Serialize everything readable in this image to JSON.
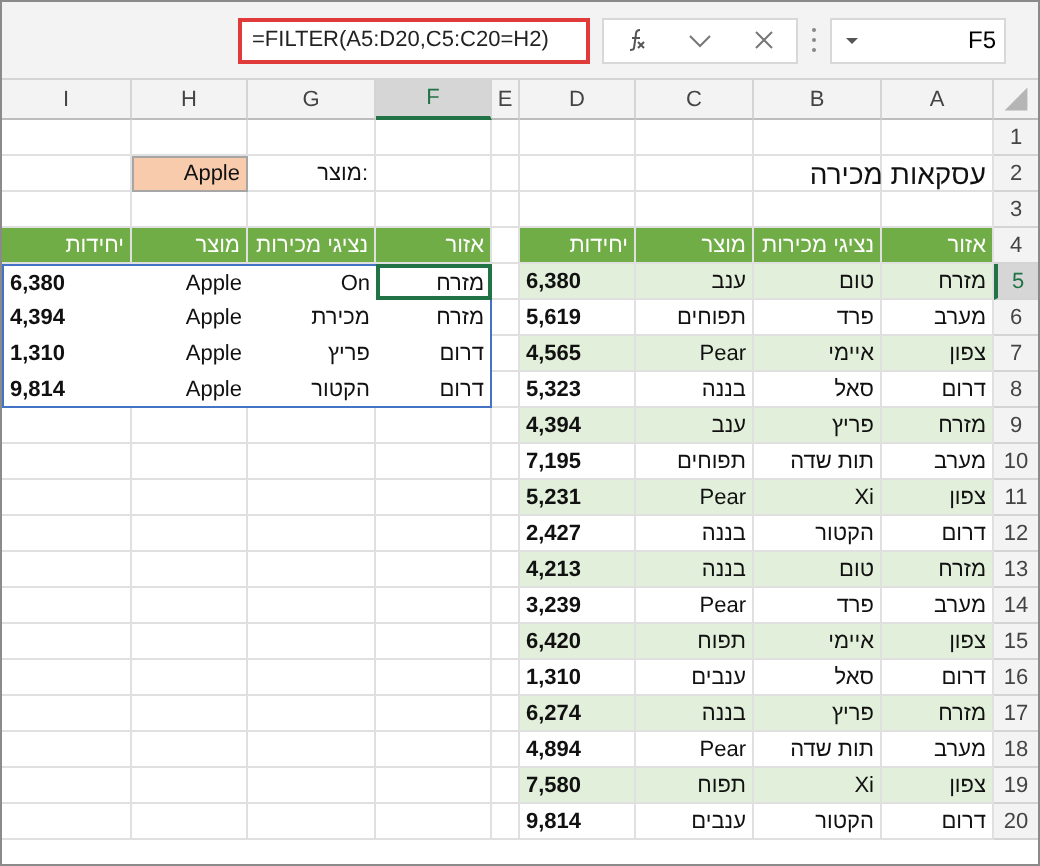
{
  "formula": "=FILTER(A5:D20,C5:C20=H2)",
  "name_box": "F5",
  "columns": [
    {
      "letter": "A",
      "selected": false
    },
    {
      "letter": "B",
      "selected": false
    },
    {
      "letter": "C",
      "selected": false
    },
    {
      "letter": "D",
      "selected": false
    },
    {
      "letter": "E",
      "selected": false
    },
    {
      "letter": "F",
      "selected": true
    },
    {
      "letter": "G",
      "selected": false
    },
    {
      "letter": "H",
      "selected": false
    },
    {
      "letter": "I",
      "selected": false
    }
  ],
  "rows": [
    {
      "number": "1",
      "selected": false
    },
    {
      "number": "2",
      "selected": false
    },
    {
      "number": "3",
      "selected": false
    },
    {
      "number": "4",
      "selected": false
    },
    {
      "number": "5",
      "selected": true
    },
    {
      "number": "6",
      "selected": false
    },
    {
      "number": "7",
      "selected": false
    },
    {
      "number": "8",
      "selected": false
    },
    {
      "number": "9",
      "selected": false
    },
    {
      "number": "10",
      "selected": false
    },
    {
      "number": "11",
      "selected": false
    },
    {
      "number": "12",
      "selected": false
    },
    {
      "number": "13",
      "selected": false
    },
    {
      "number": "14",
      "selected": false
    },
    {
      "number": "15",
      "selected": false
    },
    {
      "number": "16",
      "selected": false
    },
    {
      "number": "17",
      "selected": false
    },
    {
      "number": "18",
      "selected": false
    },
    {
      "number": "19",
      "selected": false
    },
    {
      "number": "20",
      "selected": false
    }
  ],
  "title": "עסקאות מכירה",
  "criteria": {
    "label": "מוצר:",
    "input": "Apple"
  },
  "sales_table": {
    "headers": [
      "אזור",
      "נציגי מכירות",
      "מוצר",
      "יחידות"
    ],
    "rows": [
      {
        "banded": true,
        "cells": [
          "מזרח",
          "טום",
          "ענב",
          "6,380"
        ]
      },
      {
        "banded": false,
        "cells": [
          "מערב",
          "פרד",
          "תפוחים",
          "5,619"
        ]
      },
      {
        "banded": true,
        "cells": [
          "צפון",
          "איימי",
          "Pear",
          "4,565"
        ]
      },
      {
        "banded": false,
        "cells": [
          "דרום",
          "סאל",
          "בננה",
          "5,323"
        ]
      },
      {
        "banded": true,
        "cells": [
          "מזרח",
          "פריץ",
          "ענב",
          "4,394"
        ]
      },
      {
        "banded": false,
        "cells": [
          "מערב",
          "תות שדה",
          "תפוחים",
          "7,195"
        ]
      },
      {
        "banded": true,
        "cells": [
          "צפון",
          "Xi",
          "Pear",
          "5,231"
        ]
      },
      {
        "banded": false,
        "cells": [
          "דרום",
          "הקטור",
          "בננה",
          "2,427"
        ]
      },
      {
        "banded": true,
        "cells": [
          "מזרח",
          "טום",
          "בננה",
          "4,213"
        ]
      },
      {
        "banded": false,
        "cells": [
          "מערב",
          "פרד",
          "Pear",
          "3,239"
        ]
      },
      {
        "banded": true,
        "cells": [
          "צפון",
          "איימי",
          "תפוח",
          "6,420"
        ]
      },
      {
        "banded": false,
        "cells": [
          "דרום",
          "סאל",
          "ענבים",
          "1,310"
        ]
      },
      {
        "banded": true,
        "cells": [
          "מזרח",
          "פריץ",
          "בננה",
          "6,274"
        ]
      },
      {
        "banded": false,
        "cells": [
          "מערב",
          "תות שדה",
          "Pear",
          "4,894"
        ]
      },
      {
        "banded": true,
        "cells": [
          "צפון",
          "Xi",
          "תפוח",
          "7,580"
        ]
      },
      {
        "banded": false,
        "cells": [
          "דרום",
          "הקטור",
          "ענבים",
          "9,814"
        ]
      }
    ]
  },
  "result_table": {
    "headers": [
      "אזור",
      "נציגי מכירות",
      "מוצר",
      "יחידות"
    ],
    "rows": [
      [
        {
          "text": "מזרח",
          "selected": true
        },
        {
          "text": "On",
          "selected": false
        },
        {
          "text": "Apple",
          "selected": false
        },
        {
          "text": "6,380",
          "selected": false
        }
      ],
      [
        {
          "text": "מזרח",
          "selected": false
        },
        {
          "text": "מכירת",
          "selected": false
        },
        {
          "text": "Apple",
          "selected": false
        },
        {
          "text": "4,394",
          "selected": false
        }
      ],
      [
        {
          "text": "דרום",
          "selected": false
        },
        {
          "text": "פריץ",
          "selected": false
        },
        {
          "text": "Apple",
          "selected": false
        },
        {
          "text": "1,310",
          "selected": false
        }
      ],
      [
        {
          "text": "דרום",
          "selected": false
        },
        {
          "text": "הקטור",
          "selected": false
        },
        {
          "text": "Apple",
          "selected": false
        },
        {
          "text": "9,814",
          "selected": false
        }
      ]
    ]
  }
}
